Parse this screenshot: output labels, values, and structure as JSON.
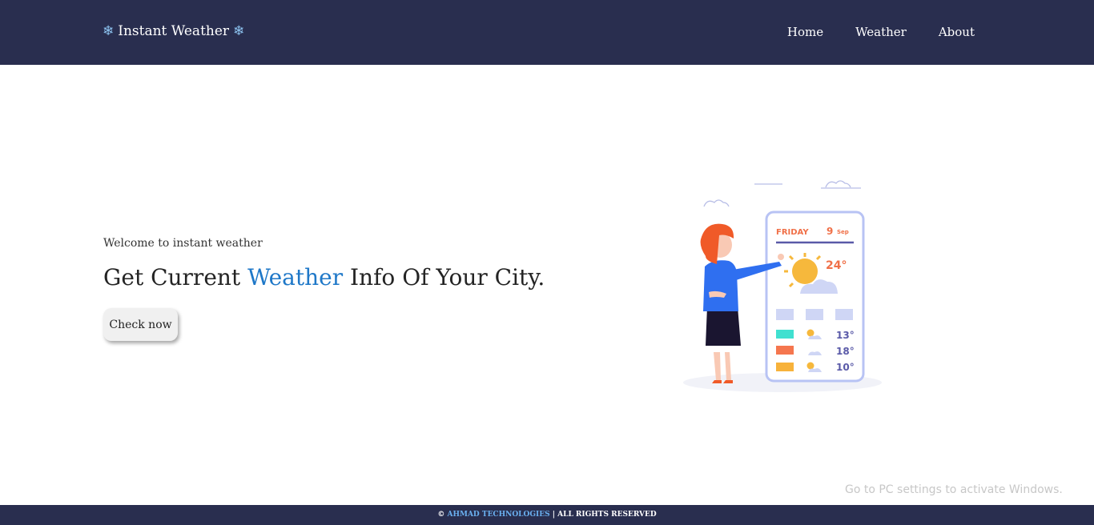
{
  "nav": {
    "brand": "Instant Weather",
    "brand_icon": "snowflake-icon",
    "links": [
      "Home",
      "Weather",
      "About"
    ]
  },
  "hero": {
    "welcome": "Welcome to instant weather",
    "headline_before": "Get Current ",
    "headline_accent": "Weather",
    "headline_after": " Info Of Your City.",
    "button": "Check now"
  },
  "illustration": {
    "day": "FRIDAY",
    "date_num": "9",
    "date_month": "Sep",
    "temp": "24°",
    "forecast": [
      {
        "color": "#40e0d0",
        "temp": "13°"
      },
      {
        "color": "#f5764e",
        "temp": "18°"
      },
      {
        "color": "#f7b23b",
        "temp": "10°"
      }
    ]
  },
  "footer": {
    "prefix": "© ",
    "company": "AHMAD TECHNOLOGIES",
    "suffix": " | ALL RIGHTS RESERVED"
  },
  "watermark": "Go to PC settings to activate Windows.",
  "colors": {
    "navbar": "#292e4f",
    "accent": "#1f78c8"
  }
}
